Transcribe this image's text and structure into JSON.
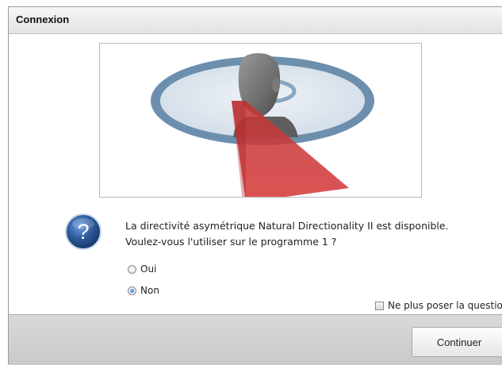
{
  "window": {
    "title": "Connexion"
  },
  "message": {
    "line1": "La directivité asymétrique Natural Directionality II est disponible.",
    "line2": "Voulez-vous l'utiliser sur le programme 1 ?"
  },
  "options": {
    "oui_label": "Oui",
    "non_label": "Non",
    "selected": "Non"
  },
  "dont_ask": {
    "label": "Ne plus poser la question",
    "checked": false
  },
  "footer": {
    "continue_label": "Continuer"
  },
  "icons": {
    "question": "question-icon",
    "illustration": "head-directivity-illustration"
  },
  "colors": {
    "ring": "#6d8fae",
    "beam": "#cc2a2a",
    "question_icon": "#2d5a9a"
  }
}
